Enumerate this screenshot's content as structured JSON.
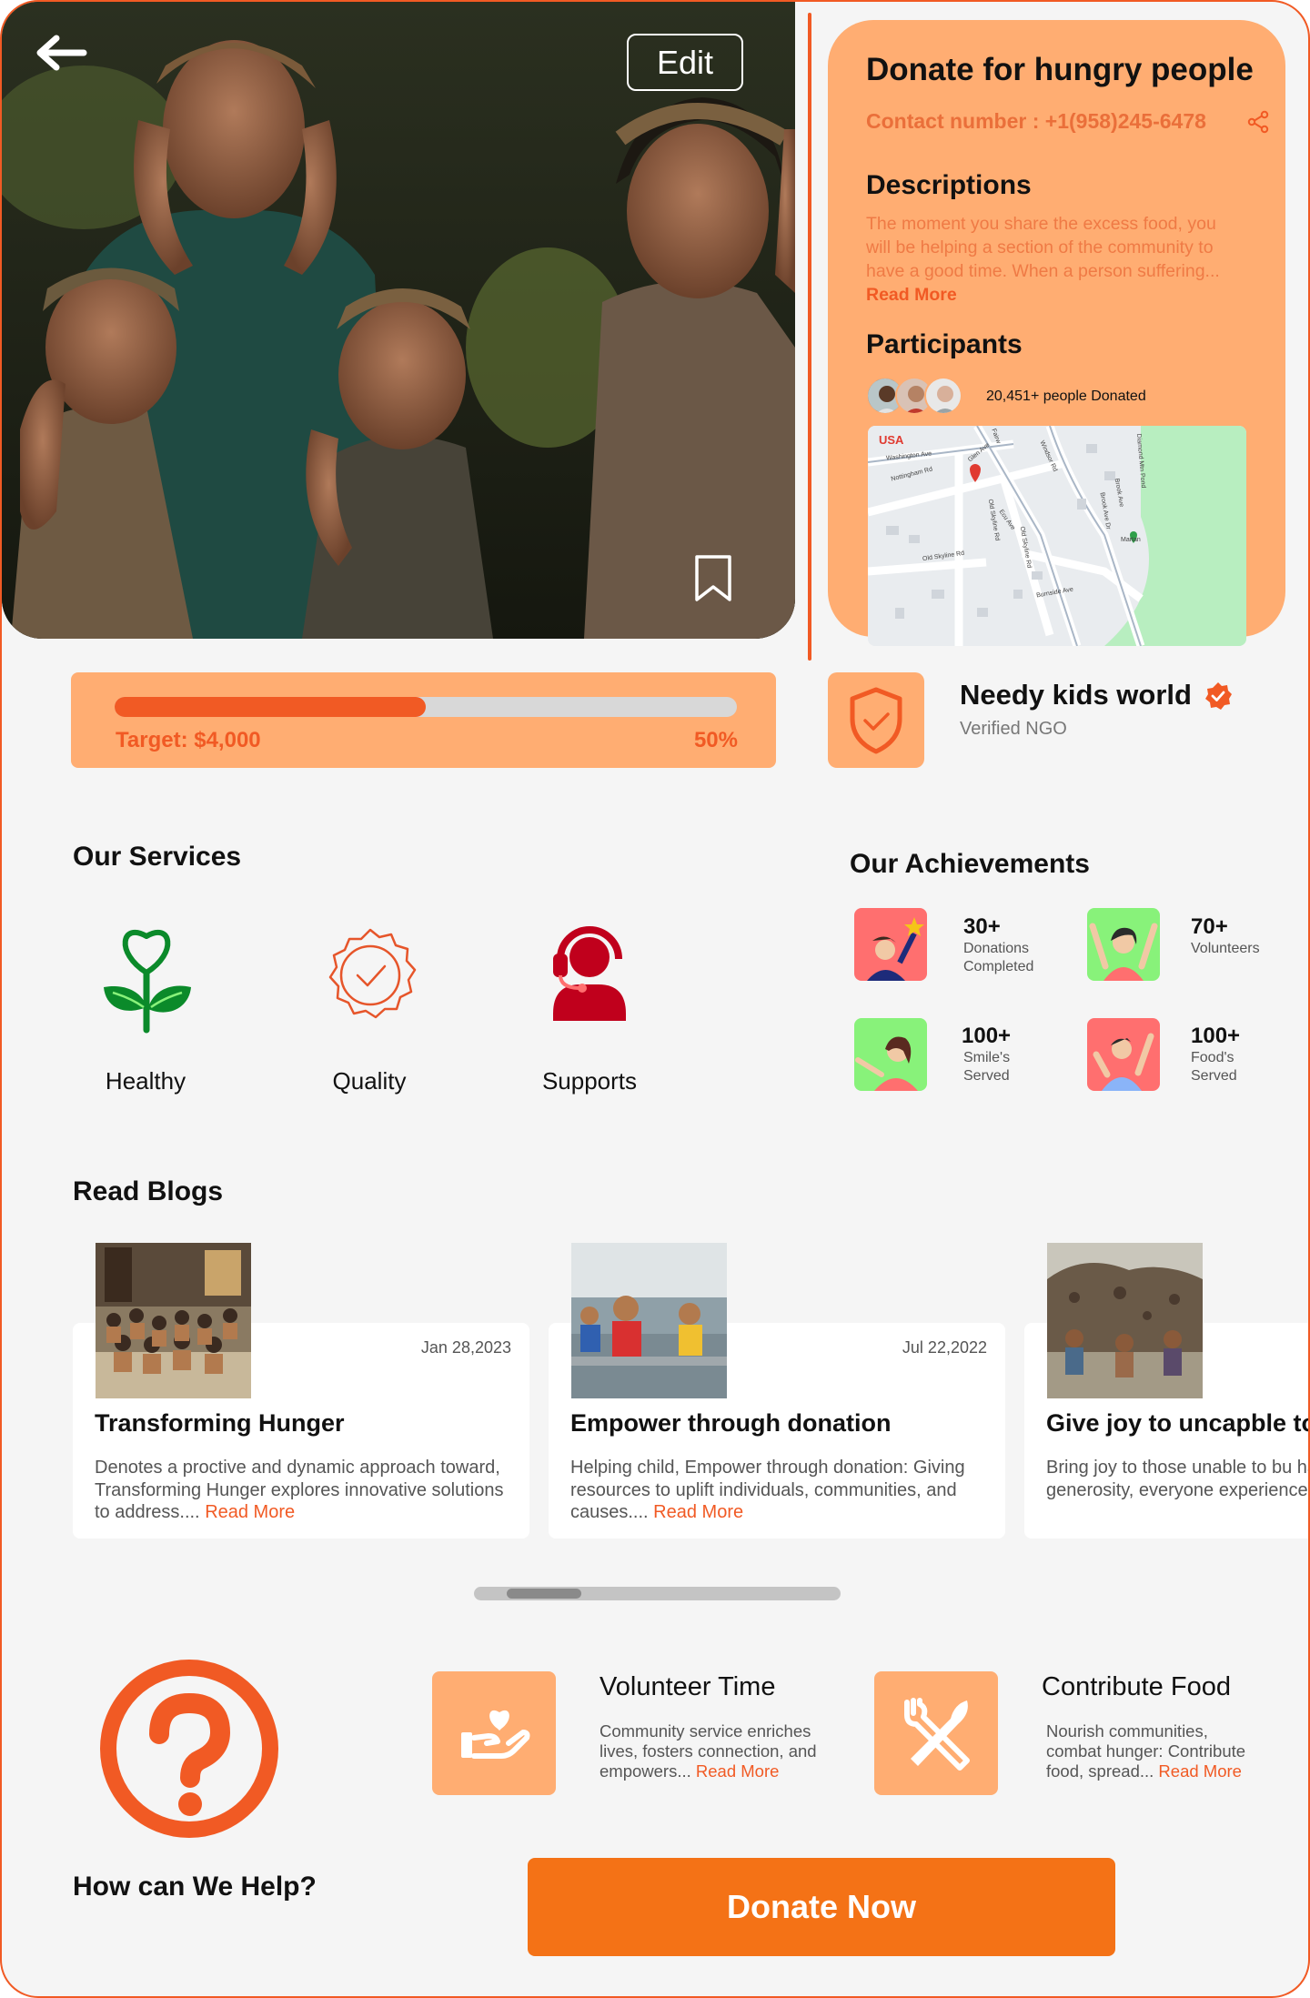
{
  "hero": {
    "edit_label": "Edit"
  },
  "info": {
    "title": "Donate for hungry people",
    "contact": "Contact number : +1(958)245-6478",
    "descriptions_heading": "Descriptions",
    "description": "The moment you share the excess food, you will be helping a section of the community to have a good time. When a person suffering...",
    "read_more": "Read More",
    "participants_heading": "Participants",
    "donated_text": "20,451+ people Donated"
  },
  "map": {
    "country": "USA",
    "streets": [
      "Washington Ave",
      "Nottingham Rd",
      "Glen Ave",
      "Fairw",
      "Old Skyline Rd",
      "Old Skyline Rd",
      "Windsor Rd",
      "Ecu Ave",
      "Burnside Ave",
      "Old Skyline Rd",
      "Brook Ave",
      "Diamond Mtn Pond",
      "Brook Ave Dr",
      "Martan"
    ]
  },
  "progress": {
    "target": "Target: $4,000",
    "percent_label": "50%",
    "fraction": 0.5
  },
  "ngo": {
    "name": "Needy kids world",
    "verified": "Verified NGO"
  },
  "services": {
    "heading": "Our Services",
    "items": [
      {
        "label": "Healthy",
        "color": "#88f27a"
      },
      {
        "label": "Quality",
        "color": "#ffad72"
      },
      {
        "label": "Supports",
        "color": "#ff6f6f"
      }
    ]
  },
  "achievements": {
    "heading": "Our Achievements",
    "items": [
      {
        "num": "30+",
        "line1": "Donations",
        "line2": "Completed"
      },
      {
        "num": "70+",
        "line1": "Volunteers",
        "line2": ""
      },
      {
        "num": "100+",
        "line1": "Smile's",
        "line2": "Served"
      },
      {
        "num": "100+",
        "line1": "Food's",
        "line2": "Served"
      }
    ]
  },
  "blogs": {
    "heading": "Read Blogs",
    "items": [
      {
        "date": "Jan 28,2023",
        "title": "Transforming Hunger",
        "text": "Denotes a proctive and dynamic approach toward, Transforming Hunger explores innovative solutions to address....",
        "read_more": "Read More"
      },
      {
        "date": "Jul 22,2022",
        "title": "Empower through donation",
        "text": "Helping child, Empower through donation: Giving resources to uplift individuals, communities, and causes....",
        "read_more": "Read More"
      },
      {
        "date": "",
        "title": "Give joy to uncapble to",
        "text": "Bring joy to those unable to bu happiness through generosity, everyone experiences the deli",
        "read_more": ""
      }
    ]
  },
  "help": {
    "heading": "How can We Help?",
    "cards": [
      {
        "title": "Volunteer Time",
        "text": "Community service enriches lives, fosters connection, and empowers...",
        "read_more": "Read More"
      },
      {
        "title": "Contribute Food",
        "text": "Nourish communities, combat hunger: Contribute food, spread...",
        "read_more": "Read More"
      }
    ]
  },
  "donate_label": "Donate Now",
  "colors": {
    "accent": "#f15a24",
    "peach": "#ffad72",
    "donate": "#f47216"
  }
}
